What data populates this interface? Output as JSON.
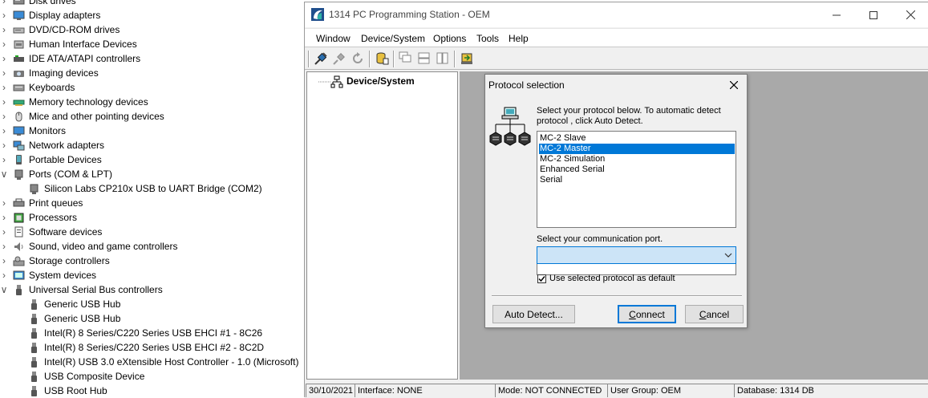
{
  "device_manager": {
    "items": [
      {
        "label": "Disk drives",
        "level": 0,
        "expanded": false,
        "icon": "disk-icon"
      },
      {
        "label": "Display adapters",
        "level": 0,
        "expanded": false,
        "icon": "display-icon"
      },
      {
        "label": "DVD/CD-ROM drives",
        "level": 0,
        "expanded": false,
        "icon": "dvd-icon"
      },
      {
        "label": "Human Interface Devices",
        "level": 0,
        "expanded": false,
        "icon": "hid-icon"
      },
      {
        "label": "IDE ATA/ATAPI controllers",
        "level": 0,
        "expanded": false,
        "icon": "ide-icon"
      },
      {
        "label": "Imaging devices",
        "level": 0,
        "expanded": false,
        "icon": "camera-icon"
      },
      {
        "label": "Keyboards",
        "level": 0,
        "expanded": false,
        "icon": "keyboard-icon"
      },
      {
        "label": "Memory technology devices",
        "level": 0,
        "expanded": false,
        "icon": "memory-icon"
      },
      {
        "label": "Mice and other pointing devices",
        "level": 0,
        "expanded": false,
        "icon": "mouse-icon"
      },
      {
        "label": "Monitors",
        "level": 0,
        "expanded": false,
        "icon": "monitor-icon"
      },
      {
        "label": "Network adapters",
        "level": 0,
        "expanded": false,
        "icon": "network-icon"
      },
      {
        "label": "Portable Devices",
        "level": 0,
        "expanded": false,
        "icon": "portable-icon"
      },
      {
        "label": "Ports (COM & LPT)",
        "level": 0,
        "expanded": true,
        "icon": "port-icon"
      },
      {
        "label": "Silicon Labs CP210x USB to UART Bridge (COM2)",
        "level": 1,
        "expanded": null,
        "icon": "port-icon"
      },
      {
        "label": "Print queues",
        "level": 0,
        "expanded": false,
        "icon": "printer-icon"
      },
      {
        "label": "Processors",
        "level": 0,
        "expanded": false,
        "icon": "processor-icon"
      },
      {
        "label": "Software devices",
        "level": 0,
        "expanded": false,
        "icon": "software-icon"
      },
      {
        "label": "Sound, video and game controllers",
        "level": 0,
        "expanded": false,
        "icon": "sound-icon"
      },
      {
        "label": "Storage controllers",
        "level": 0,
        "expanded": false,
        "icon": "storage-icon"
      },
      {
        "label": "System devices",
        "level": 0,
        "expanded": false,
        "icon": "system-icon"
      },
      {
        "label": "Universal Serial Bus controllers",
        "level": 0,
        "expanded": true,
        "icon": "usb-icon"
      },
      {
        "label": "Generic USB Hub",
        "level": 1,
        "expanded": null,
        "icon": "usb-icon"
      },
      {
        "label": "Generic USB Hub",
        "level": 1,
        "expanded": null,
        "icon": "usb-icon"
      },
      {
        "label": "Intel(R) 8 Series/C220 Series USB EHCI #1 - 8C26",
        "level": 1,
        "expanded": null,
        "icon": "usb-icon"
      },
      {
        "label": "Intel(R) 8 Series/C220 Series USB EHCI #2 - 8C2D",
        "level": 1,
        "expanded": null,
        "icon": "usb-icon"
      },
      {
        "label": "Intel(R) USB 3.0 eXtensible Host Controller - 1.0 (Microsoft)",
        "level": 1,
        "expanded": null,
        "icon": "usb-icon"
      },
      {
        "label": "USB Composite Device",
        "level": 1,
        "expanded": null,
        "icon": "usb-icon"
      },
      {
        "label": "USB Root Hub",
        "level": 1,
        "expanded": null,
        "icon": "usb-icon"
      }
    ]
  },
  "app": {
    "title": "1314 PC Programming Station - OEM",
    "logo_icon": "app-logo-icon",
    "menu": [
      "Window",
      "Device/System",
      "Options",
      "Tools",
      "Help"
    ],
    "toolbar": [
      "connect-icon",
      "disconnect-icon",
      "refresh-icon",
      "database-icon",
      "cascade-icon",
      "tile-horizontal-icon",
      "tile-vertical-icon",
      "device-icon"
    ],
    "tree_root": "Device/System",
    "status": {
      "date": "30/10/2021",
      "interface": "Interface: NONE",
      "mode": "Mode: NOT CONNECTED",
      "user_group": "User Group: OEM",
      "database": "Database: 1314 DB"
    }
  },
  "dialog": {
    "title": "Protocol selection",
    "instruction": "Select your protocol below. To automatic detect protocol , click Auto Detect.",
    "protocols": [
      "MC-2 Slave",
      "MC-2 Master",
      "MC-2 Simulation",
      "Enhanced Serial",
      "Serial"
    ],
    "selected_protocol": "MC-2 Master",
    "port_label": "Select your communication port.",
    "port_value": "",
    "default_checkbox_label": "Use selected protocol as default",
    "default_checked": true,
    "buttons": {
      "auto_detect": "Auto Detect...",
      "connect": "Connect",
      "cancel": "Cancel"
    }
  },
  "colors": {
    "selection": "#0078d7",
    "mdi_background": "#a9a9a9",
    "combo_highlight": "#cce4f7"
  }
}
